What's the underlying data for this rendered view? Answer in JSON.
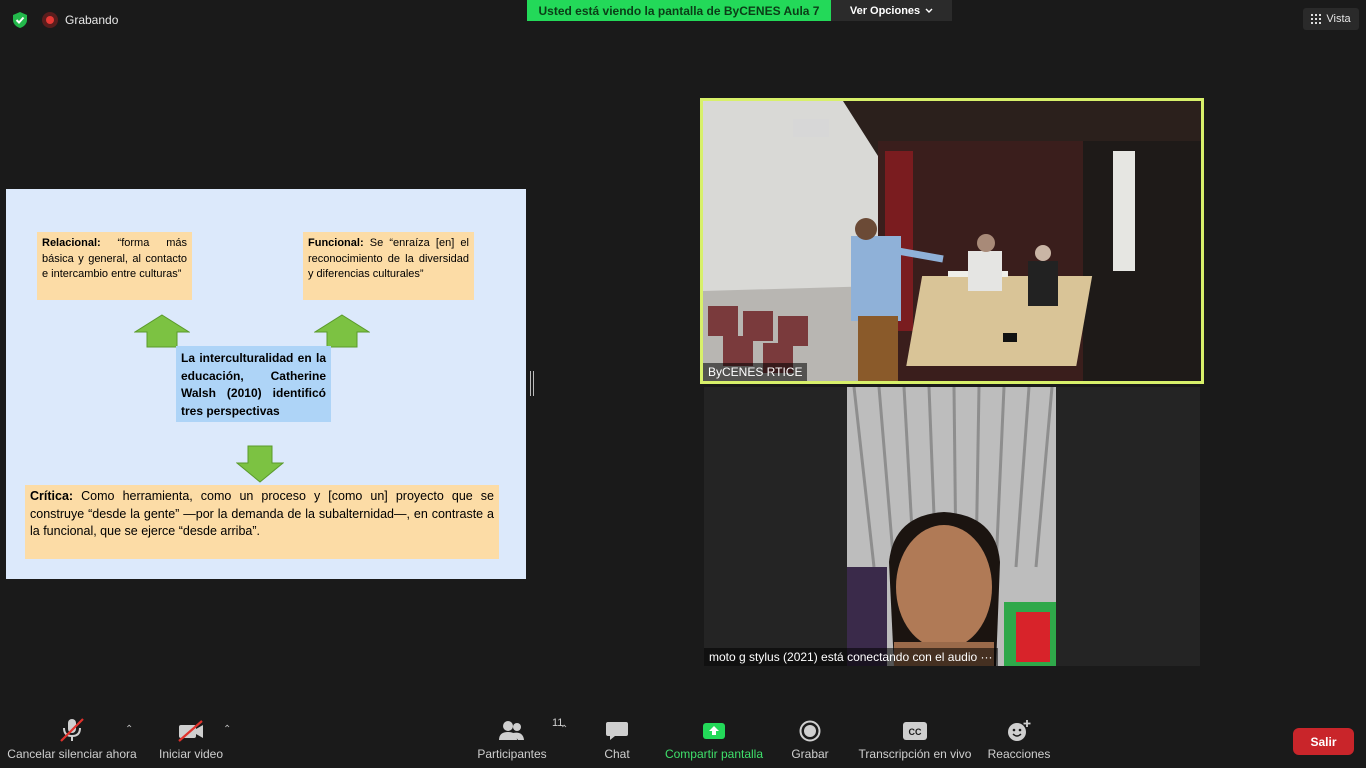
{
  "top": {
    "recording_label": "Grabando",
    "share_banner": "Usted está viendo la pantalla de ByCENES Aula 7",
    "view_options": "Ver Opciones",
    "view_label": "Vista"
  },
  "slide": {
    "relacional_head": "Relacional:",
    "relacional_body": " “forma más básica y general, al contacto e intercambio entre culturas”",
    "funcional_head": "Funcional:",
    "funcional_body": " Se “enraíza [en] el reconocimiento de la diversidad y diferencias culturales”",
    "center": "La interculturalidad en la educación, Catherine Walsh (2010) identificó tres perspectivas",
    "critica_head": "Crítica:",
    "critica_body": "  Como herramienta, como un proceso y [como un] proyecto que se construye “desde la gente” —por la demanda de la subalternidad—, en contraste a la funcional, que se ejerce “desde arriba”."
  },
  "videos": [
    {
      "name": "ByCENES RTICE"
    },
    {
      "name": "moto g stylus (2021) está conectando con el audio ···"
    }
  ],
  "toolbar": {
    "mute": "Cancelar silenciar ahora",
    "video": "Iniciar video",
    "participants": "Participantes",
    "participants_count": "11",
    "chat": "Chat",
    "share": "Compartir pantalla",
    "record": "Grabar",
    "cc_badge": "CC",
    "transcription": "Transcripción en vivo",
    "reactions": "Reacciones",
    "leave": "Salir"
  },
  "colors": {
    "banner_green": "#23d959",
    "share_green": "#23d959",
    "active_speaker_border": "#d8f06a",
    "leave_red": "#c9252a"
  }
}
